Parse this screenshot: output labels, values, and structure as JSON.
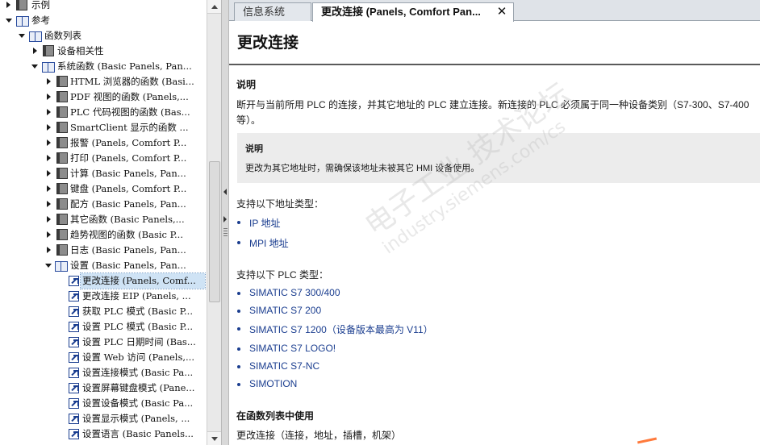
{
  "tree": {
    "rows": [
      {
        "label": "示例"
      },
      {
        "label": "参考"
      },
      {
        "label": "函数列表"
      },
      {
        "label": "设备相关性"
      },
      {
        "label": "系统函数 (Basic Panels, Pan..."
      },
      {
        "label": "HTML 浏览器的函数 (Basi..."
      },
      {
        "label": "PDF 视图的函数 (Panels,..."
      },
      {
        "label": "PLC 代码视图的函数 (Bas..."
      },
      {
        "label": "SmartClient 显示的函数 ..."
      },
      {
        "label": "报警 (Panels, Comfort P..."
      },
      {
        "label": "打印 (Panels, Comfort P..."
      },
      {
        "label": "计算 (Basic Panels, Pan..."
      },
      {
        "label": "键盘 (Panels, Comfort P..."
      },
      {
        "label": "配方 (Basic Panels, Pan..."
      },
      {
        "label": "其它函数 (Basic Panels,..."
      },
      {
        "label": "趋势视图的函数 (Basic P..."
      },
      {
        "label": "日志 (Basic Panels, Pan..."
      },
      {
        "label": "设置 (Basic Panels, Pan..."
      },
      {
        "label": "更改连接 (Panels, Comf..."
      },
      {
        "label": "更改连接 EIP (Panels, ..."
      },
      {
        "label": "获取 PLC 模式 (Basic P..."
      },
      {
        "label": "设置 PLC 模式 (Basic P..."
      },
      {
        "label": "设置 PLC 日期时间 (Bas..."
      },
      {
        "label": "设置 Web 访问 (Panels,..."
      },
      {
        "label": "设置连接模式 (Basic Pa..."
      },
      {
        "label": "设置屏幕键盘模式 (Pane..."
      },
      {
        "label": "设置设备模式 (Basic Pa..."
      },
      {
        "label": "设置显示模式 (Panels, ..."
      },
      {
        "label": "设置语言 (Basic Panels..."
      }
    ]
  },
  "tabs": {
    "info_label": "信息系统",
    "active_label": "更改连接 (Panels, Comfort Pan...",
    "close_glyph": "✕"
  },
  "article": {
    "title": "更改连接",
    "desc_heading": "说明",
    "desc_line1": "断开与当前所用 PLC 的连接，并其它地址的 PLC 建立连接。新连接的 PLC 必须属于同一种设备类别（S7-300、S7-400",
    "desc_line2": "等）。",
    "note_heading": "说明",
    "note_text": "更改为其它地址时，需确保该地址未被其它 HMI 设备使用。",
    "address_intro": "支持以下地址类型：",
    "address_types": [
      "IP 地址",
      "MPI 地址"
    ],
    "plc_intro": "支持以下 PLC 类型：",
    "plc_types": [
      "SIMATIC S7 300/400",
      "SIMATIC S7 200",
      "SIMATIC S7 1200（设备版本最高为 V11）",
      "SIMATIC S7 LOGO!",
      "SIMATIC S7-NC",
      "SIMOTION"
    ],
    "usage_heading": "在函数列表中使用",
    "usage_text": "更改连接（连接，地址，插槽，机架）"
  },
  "watermark": {
    "line1": "电子工业 技术论坛",
    "line2": "industry.siemens.com/cs"
  }
}
